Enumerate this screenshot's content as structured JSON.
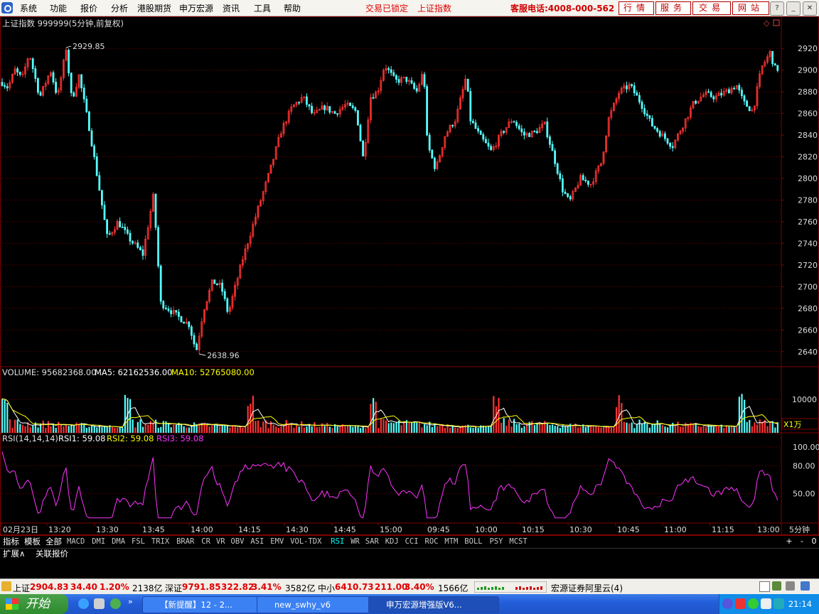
{
  "menu": [
    "系统",
    "功能",
    "报价",
    "分析",
    "港股期货",
    "申万宏源",
    "资讯",
    "工具",
    "帮助"
  ],
  "red_links": [
    "交易已锁定",
    "上证指数"
  ],
  "hotline": "客服电话:4008-000-562",
  "service_buttons": [
    "行情",
    "服务",
    "交易",
    "网站"
  ],
  "chart": {
    "title": "上证指数 999999(5分钟,前复权)",
    "high_label": "2929.85",
    "low_label": "2638.96",
    "price_ticks": [
      "2920",
      "2900",
      "2880",
      "2860",
      "2840",
      "2820",
      "2800",
      "2780",
      "2760",
      "2740",
      "2720",
      "2700",
      "2680",
      "2660",
      "2640"
    ],
    "volume_line": {
      "label": "VOLUME: 95682368.00",
      "ma5": "MA5: 62162536.00",
      "ma10": "MA10: 52765080.00"
    },
    "volume_tick": "10000",
    "volume_unit": "X1万",
    "rsi_line": {
      "label": "RSI(14,14,14)",
      "rsi1": "RSI1: 59.08",
      "rsi2": "RSI2: 59.08",
      "rsi3": "RSI3: 59.08"
    },
    "rsi_ticks": [
      "100.00",
      "80.00",
      "50.00"
    ],
    "time_labels": [
      "02月23日",
      "13:20",
      "13:30",
      "13:45",
      "14:00",
      "14:15",
      "14:30",
      "14:45",
      "15:00",
      "09:45",
      "10:00",
      "10:15",
      "10:30",
      "10:45",
      "11:00",
      "11:15",
      "13:00"
    ],
    "period": "5分钟",
    "colors": {
      "up": "#ff3232",
      "down": "#54ffff",
      "grid": "#800000",
      "ma5": "#ffffff",
      "ma10": "#ffff00",
      "rsi": "#ff33ff"
    }
  },
  "indicator_tabs": [
    "指标",
    "模板",
    "全部",
    "MACD",
    "DMI",
    "DMA",
    "FSL",
    "TRIX",
    "BRAR",
    "CR",
    "VR",
    "OBV",
    "ASI",
    "EMV",
    "VOL-TDX",
    "RSI",
    "WR",
    "SAR",
    "KDJ",
    "CCI",
    "ROC",
    "MTM",
    "BOLL",
    "PSY",
    "MCST"
  ],
  "selected_tab": "RSI",
  "tab_controls": [
    "+",
    "-",
    "0"
  ],
  "expand_tabs": [
    "扩展∧",
    "关联报价"
  ],
  "status": {
    "sh_label": "上证",
    "sh_value": "2904.83",
    "sh_change": "34.40",
    "sh_pct": "1.20%",
    "sh_amount": "2138亿",
    "sz_label": "深证",
    "sz_value": "9791.85",
    "sz_change": "322.82",
    "sz_pct": "3.41%",
    "sz_amount": "3582亿",
    "zx_label": "中小",
    "zx_value": "6410.73",
    "zx_change": "211.00",
    "zx_pct": "3.40%",
    "zx_amount": "1566亿",
    "server": "宏源证券阿里云(4)"
  },
  "taskbar": {
    "start": "开始",
    "items": [
      "【新提醒】12 - 2...",
      "new_swhy_v6",
      "申万宏源增强版V6..."
    ],
    "clock": "21:14"
  }
}
